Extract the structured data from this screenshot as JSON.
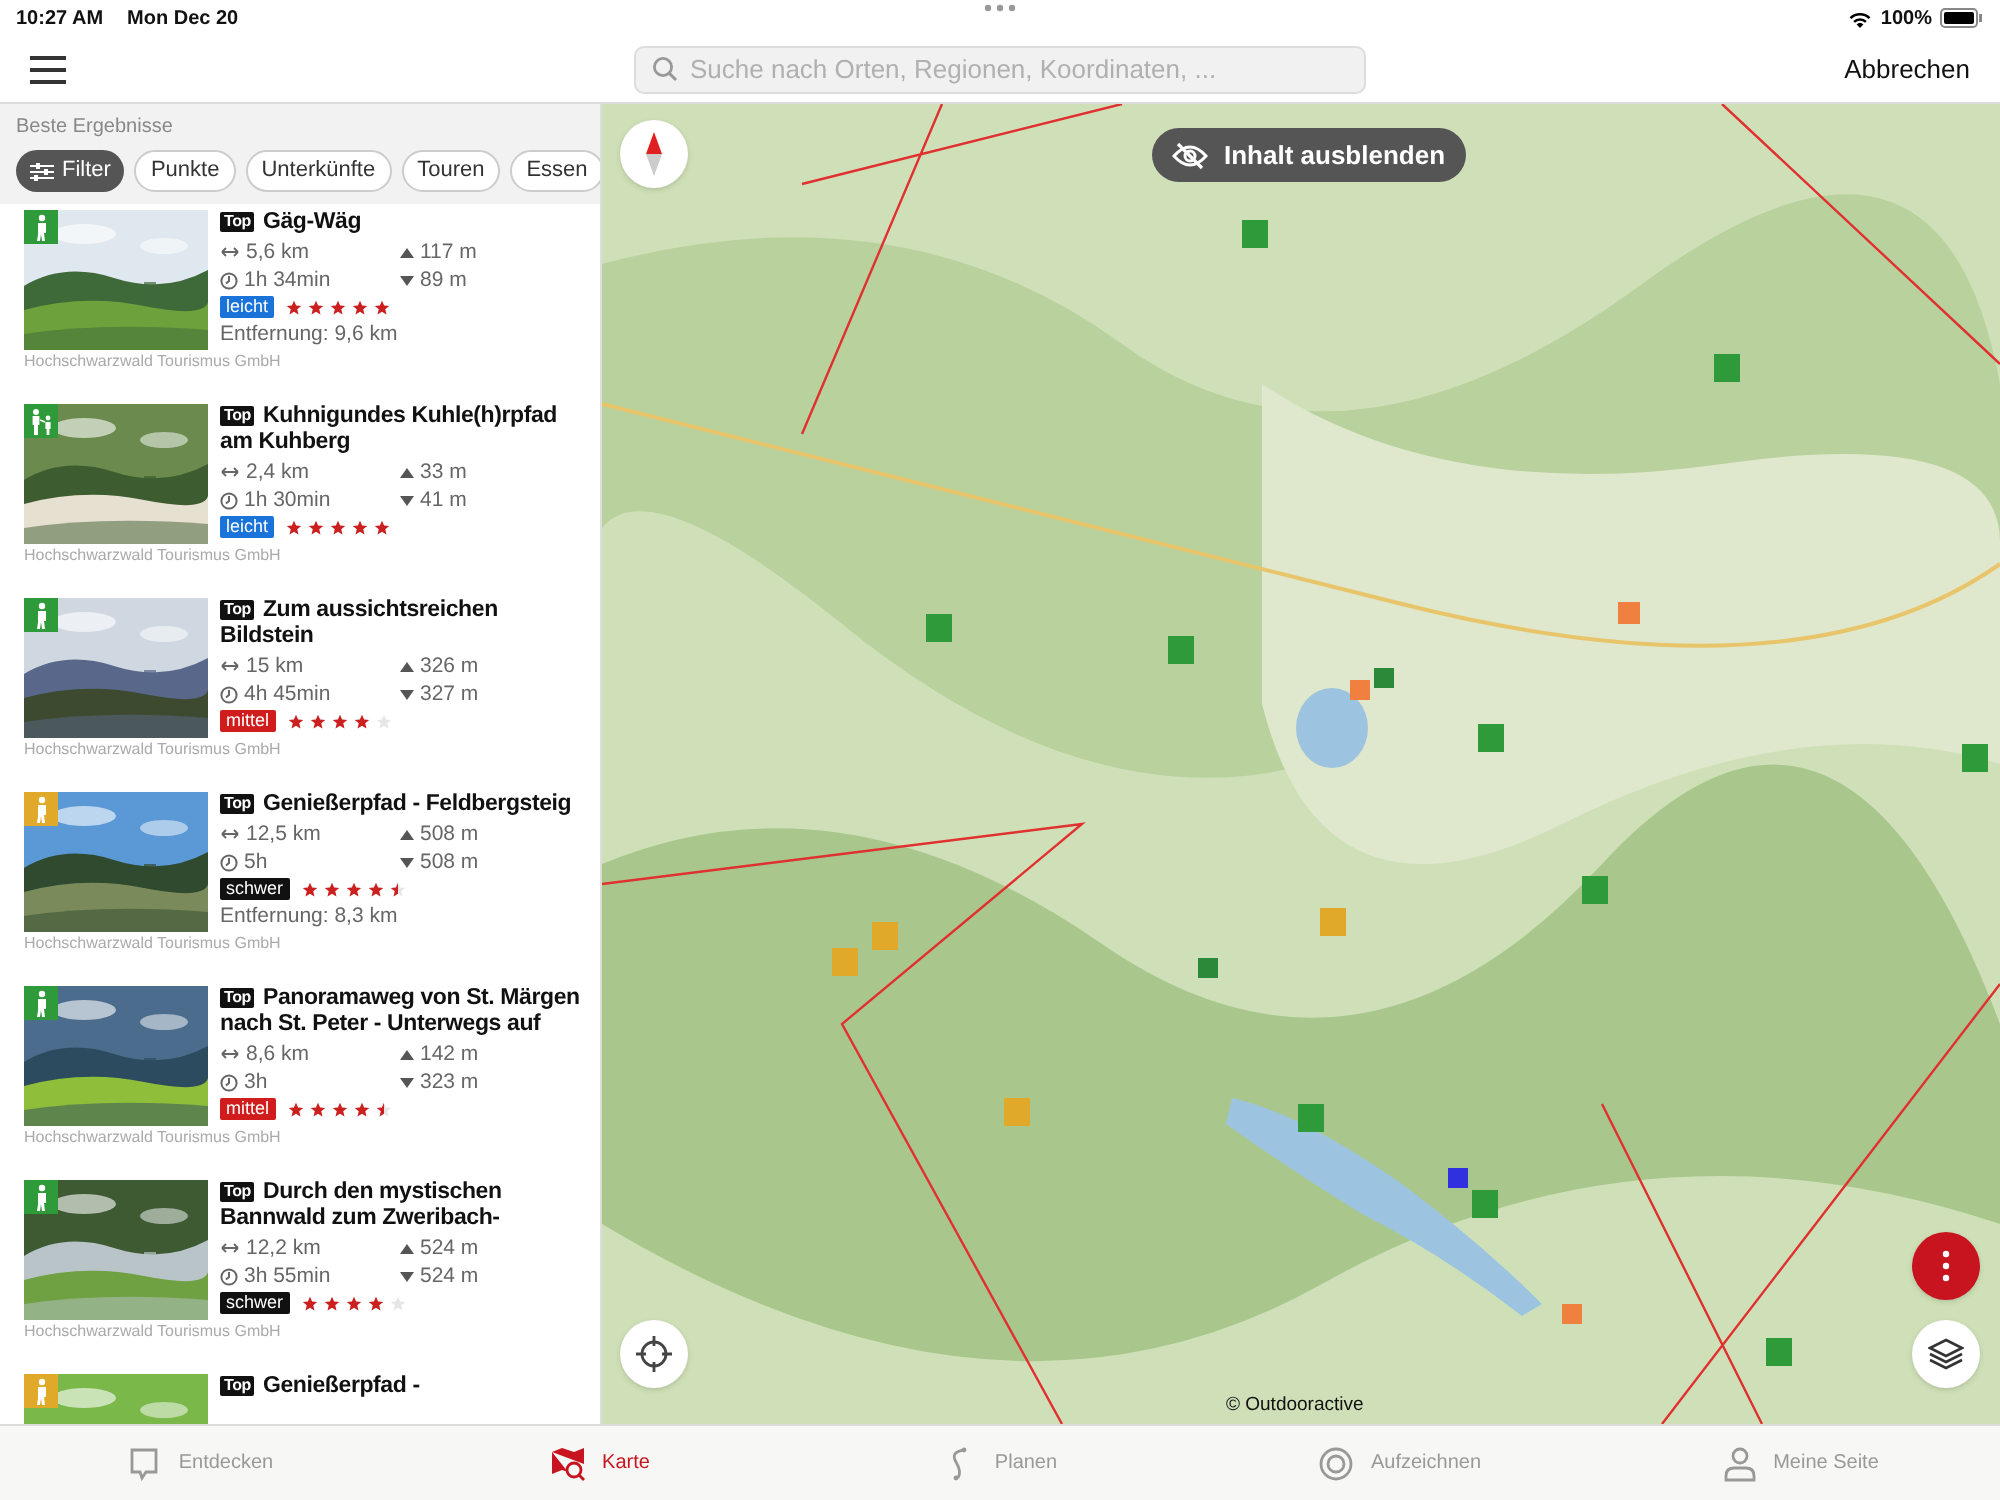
{
  "status_bar": {
    "time": "10:27 AM",
    "date": "Mon Dec 20",
    "battery": "100%"
  },
  "header": {
    "search": {
      "placeholder": "Suche nach Orten, Regionen, Koordinaten, ..."
    },
    "cancel": "Abbrechen"
  },
  "results": {
    "heading": "Beste Ergebnisse",
    "chips": [
      {
        "label": "Filter",
        "selected": true
      },
      {
        "label": "Punkte",
        "selected": false
      },
      {
        "label": "Unterkünfte",
        "selected": false
      },
      {
        "label": "Touren",
        "selected": false
      },
      {
        "label": "Essen",
        "selected": false
      }
    ],
    "items": [
      {
        "kind": "hiker",
        "color": "#2f9a3a",
        "badge": "Top",
        "title": "Gäg-Wäg",
        "distance": "5,6 km",
        "duration": "1h 34min",
        "ascent": "117 m",
        "descent": "89 m",
        "difficulty": {
          "label": "leicht",
          "color": "#1a73d9"
        },
        "stars": 5,
        "away": "Entfernung: 9,6 km",
        "source": "Hochschwarzwald Tourismus GmbH"
      },
      {
        "kind": "family",
        "color": "#2f9a3a",
        "badge": "Top",
        "title": "Kuhnigundes Kuhle(h)rpfad am Kuhberg",
        "distance": "2,4 km",
        "duration": "1h 30min",
        "ascent": "33 m",
        "descent": "41 m",
        "difficulty": {
          "label": "leicht",
          "color": "#1a73d9"
        },
        "stars": 5,
        "source": "Hochschwarzwald Tourismus GmbH"
      },
      {
        "kind": "hiker",
        "color": "#2f9a3a",
        "badge": "Top",
        "title": "Zum aussichtsreichen Bildstein",
        "distance": "15 km",
        "duration": "4h 45min",
        "ascent": "326 m",
        "descent": "327 m",
        "difficulty": {
          "label": "mittel",
          "color": "#d01c1c"
        },
        "stars": 4,
        "source": "Hochschwarzwald Tourismus GmbH"
      },
      {
        "kind": "hiker",
        "color": "#e0a92a",
        "badge": "Top",
        "title": "Genießerpfad - Feldbergsteig",
        "distance": "12,5 km",
        "duration": "5h",
        "ascent": "508 m",
        "descent": "508 m",
        "difficulty": {
          "label": "schwer",
          "color": "#111111"
        },
        "stars": 4.5,
        "away": "Entfernung: 8,3 km",
        "source": "Hochschwarzwald Tourismus GmbH"
      },
      {
        "kind": "hiker",
        "color": "#2f9a3a",
        "badge": "Top",
        "title": "Panoramaweg von St. Märgen nach St. Peter - Unterwegs auf",
        "distance": "8,6 km",
        "duration": "3h",
        "ascent": "142 m",
        "descent": "323 m",
        "difficulty": {
          "label": "mittel",
          "color": "#d01c1c"
        },
        "stars": 4.5,
        "source": "Hochschwarzwald Tourismus GmbH"
      },
      {
        "kind": "hiker",
        "color": "#2f9a3a",
        "badge": "Top",
        "title": "Durch den mystischen Bannwald zum Zweribach-",
        "distance": "12,2 km",
        "duration": "3h 55min",
        "ascent": "524 m",
        "descent": "524 m",
        "difficulty": {
          "label": "schwer",
          "color": "#111111"
        },
        "stars": 4,
        "source": "Hochschwarzwald Tourismus GmbH"
      },
      {
        "kind": "hiker",
        "color": "#e0a92a",
        "badge": "Top",
        "title": "Genießerpfad -"
      }
    ]
  },
  "map": {
    "toggle": "Inhalt ausblenden",
    "credit": "© Outdooractive"
  },
  "tab_bar": [
    {
      "label": "Entdecken",
      "selected": false
    },
    {
      "label": "Karte",
      "selected": true
    },
    {
      "label": "Planen",
      "selected": false
    },
    {
      "label": "Aufzeichnen",
      "selected": false
    },
    {
      "label": "Meine Seite",
      "selected": false
    }
  ]
}
